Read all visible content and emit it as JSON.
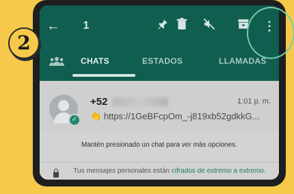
{
  "toolbar": {
    "back_icon": "arrow-left-icon",
    "selected_count": "1",
    "pin_icon": "pin-icon",
    "delete_icon": "trash-icon",
    "mute_icon": "mute-icon",
    "archive_icon": "archive-icon",
    "more_icon": "more-vert-icon"
  },
  "tabs": {
    "community_icon": "community-icon",
    "items": [
      {
        "label": "CHATS"
      },
      {
        "label": "ESTADOS"
      },
      {
        "label": "LLAMADAS"
      }
    ],
    "active": "CHATS"
  },
  "chat": {
    "name_prefix": "+52",
    "time": "1:01 p. m.",
    "preview": "https://1GeBFcpOm_-j819xb52gdkkG...",
    "preview_emoji": "👏"
  },
  "hint": "Mantén presionado un chat para ver más opciones.",
  "encryption": {
    "text_before": "Tus mensajes personales están ",
    "link": "cifrados de extremo a extremo",
    "text_after": "."
  },
  "step_badge": "2",
  "colors": {
    "background": "#f6c94a",
    "header": "#0f5e50",
    "highlight": "#6fd0a4",
    "link": "#1c7a5c"
  }
}
